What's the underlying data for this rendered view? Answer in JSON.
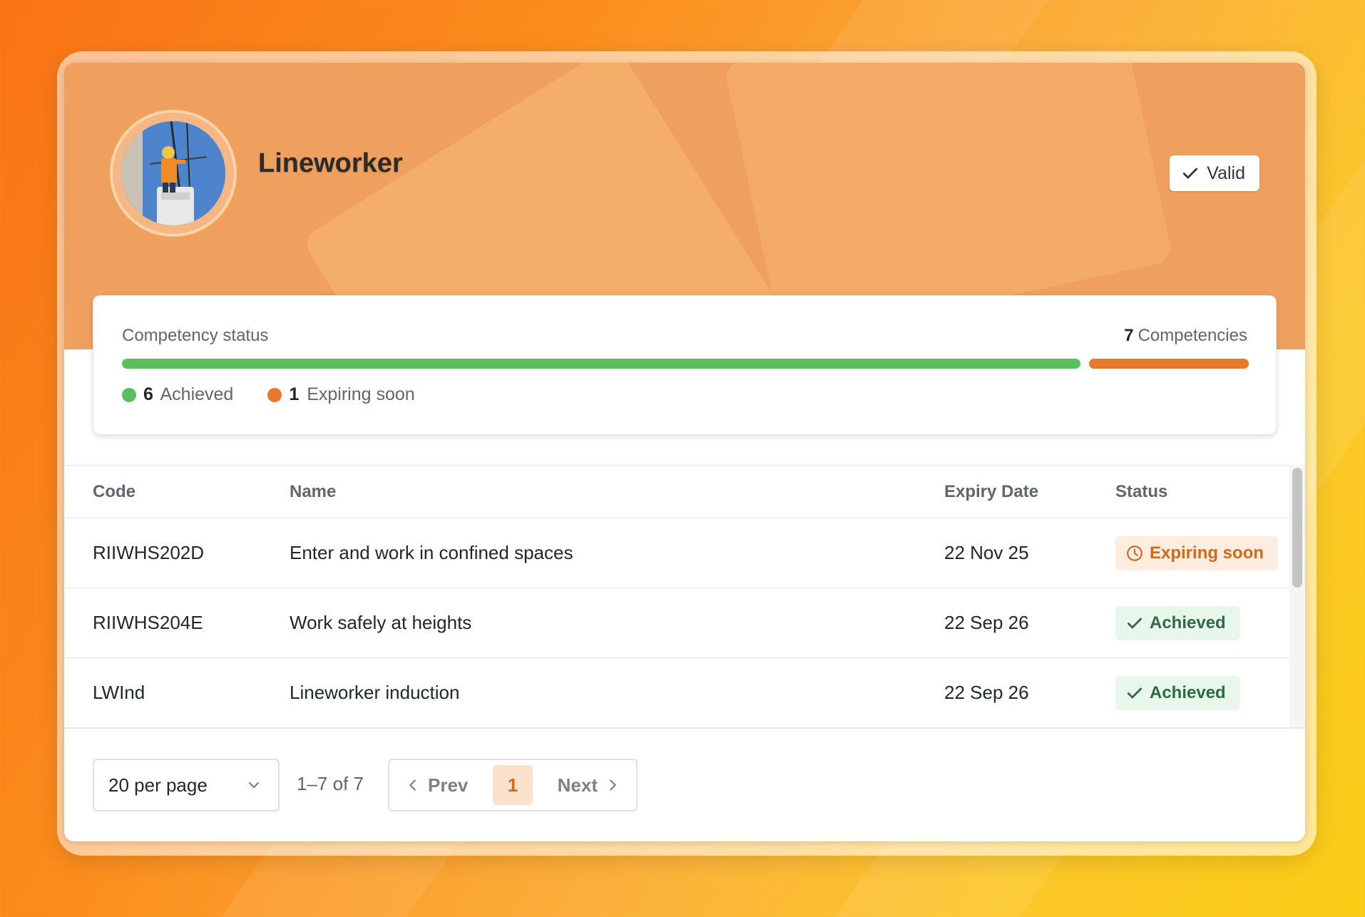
{
  "profile": {
    "role_title": "Lineworker",
    "avatar_icon": "lineworker-photo",
    "valid_label": "Valid"
  },
  "competency": {
    "status_label": "Competency status",
    "total_count": "7",
    "total_label": "Competencies",
    "achieved_count": "6",
    "achieved_label": "Achieved",
    "expiring_count": "1",
    "expiring_label": "Expiring soon",
    "achieved_fraction": 0.857,
    "expiring_fraction": 0.143,
    "colors": {
      "achieved": "#5cbf5f",
      "expiring": "#e8782a"
    }
  },
  "table": {
    "headers": {
      "code": "Code",
      "name": "Name",
      "expiry": "Expiry Date",
      "status": "Status"
    },
    "rows": [
      {
        "code": "RIIWHS202D",
        "name": "Enter and work in confined spaces",
        "expiry": "22 Nov 25",
        "status": "Expiring soon",
        "status_type": "expiring"
      },
      {
        "code": "RIIWHS204E",
        "name": "Work safely at heights",
        "expiry": "22 Sep 26",
        "status": "Achieved",
        "status_type": "achieved"
      },
      {
        "code": "LWInd",
        "name": "Lineworker induction",
        "expiry": "22 Sep 26",
        "status": "Achieved",
        "status_type": "achieved"
      }
    ]
  },
  "pagination": {
    "per_page_label": "20 per page",
    "range_text": "1–7 of 7",
    "prev_label": "Prev",
    "next_label": "Next",
    "current_page": "1"
  }
}
